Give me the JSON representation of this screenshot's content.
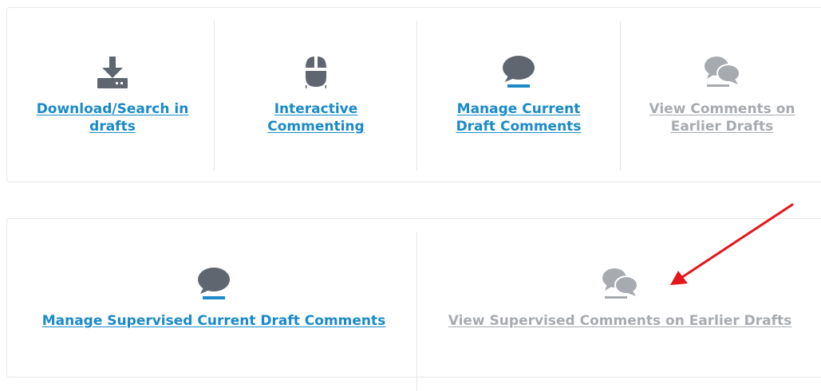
{
  "top_row": {
    "tiles": [
      {
        "label_line1": "Download/Search in",
        "label_line2": "drafts",
        "icon": "download-icon",
        "state": "active"
      },
      {
        "label_line1": "Interactive",
        "label_line2": "Commenting",
        "icon": "mouse-icon",
        "state": "active"
      },
      {
        "label_line1": "Manage Current",
        "label_line2": "Draft Comments",
        "icon": "comment-icon",
        "state": "active"
      },
      {
        "label_line1": "View Comments on",
        "label_line2": "Earlier Drafts",
        "icon": "comments-icon",
        "state": "muted"
      }
    ]
  },
  "bottom_row": {
    "tiles": [
      {
        "label": "Manage Supervised Current Draft Comments",
        "icon": "comment-icon",
        "state": "active"
      },
      {
        "label": "View Supervised Comments on Earlier Drafts",
        "icon": "comments-icon",
        "state": "muted"
      }
    ]
  },
  "colors": {
    "link_active": "#1a8ac8",
    "link_muted": "#a7abb0",
    "icon_dark": "#5f6670",
    "icon_muted": "#a7abb0",
    "accent_underline": "#1a8ac8",
    "annotation_arrow": "#e3161b"
  }
}
